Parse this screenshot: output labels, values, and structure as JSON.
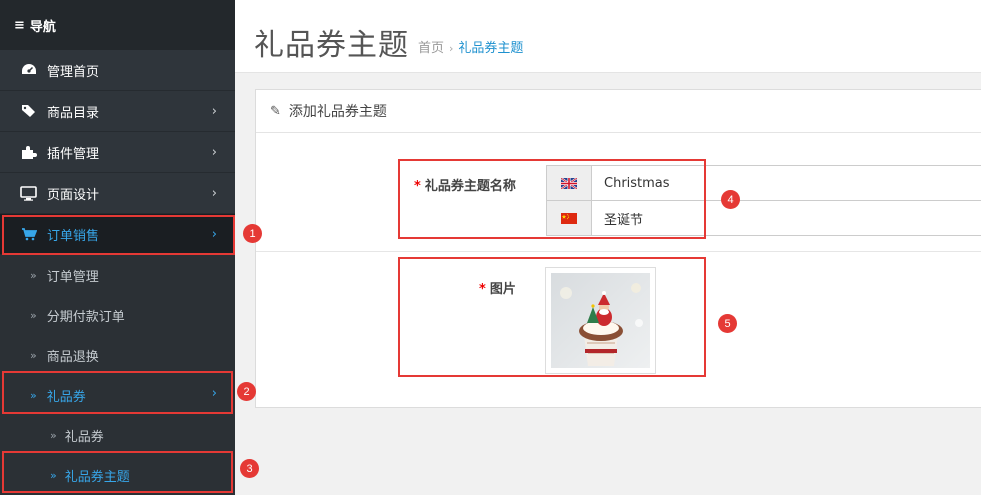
{
  "nav": {
    "header": "导航",
    "items": [
      {
        "label": "管理首页",
        "icon": "dashboard-icon",
        "has_chevron": false
      },
      {
        "label": "商品目录",
        "icon": "tag-icon",
        "has_chevron": true
      },
      {
        "label": "插件管理",
        "icon": "puzzle-icon",
        "has_chevron": true
      },
      {
        "label": "页面设计",
        "icon": "monitor-icon",
        "has_chevron": true
      },
      {
        "label": "订单销售",
        "icon": "cart-icon",
        "has_chevron": true,
        "active": true
      }
    ],
    "sub_items": [
      {
        "label": "订单管理"
      },
      {
        "label": "分期付款订单"
      },
      {
        "label": "商品退换"
      },
      {
        "label": "礼品券",
        "expanded": true
      }
    ],
    "sub2_items": [
      {
        "label": "礼品券"
      },
      {
        "label": "礼品券主题",
        "active": true
      }
    ]
  },
  "page": {
    "title": "礼品券主题",
    "breadcrumb": {
      "home": "首页",
      "current": "礼品券主题"
    }
  },
  "panel": {
    "heading": "添加礼品券主题",
    "name_label": "礼品券主题名称",
    "required_mark": "*",
    "name_values": [
      {
        "lang": "en",
        "flag": "uk-flag-icon",
        "value": "Christmas"
      },
      {
        "lang": "zh",
        "flag": "china-flag-icon",
        "value": "圣诞节"
      }
    ],
    "image_label": "图片"
  },
  "annotations": [
    "1",
    "2",
    "3",
    "4",
    "5"
  ],
  "colors": {
    "accent": "#37a6e9",
    "annotation": "#e53935",
    "sidebar": "#2b3035"
  }
}
